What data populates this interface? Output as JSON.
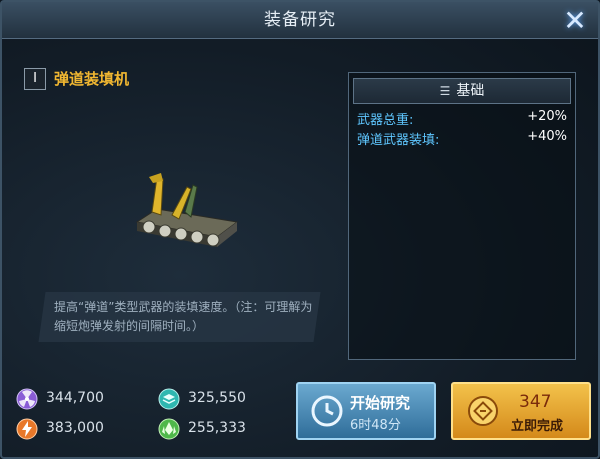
{
  "window": {
    "title": "装备研究",
    "close_icon": "close-icon"
  },
  "item": {
    "tier": "I",
    "name": "弹道装填机"
  },
  "description": "提高“弹道”类型武器的装填速度。（注：可理解为缩短炮弹发射的间隔时间。）",
  "stats": {
    "header": "基础",
    "rows": [
      {
        "label": "武器总重:",
        "value": "+20%"
      },
      {
        "label": "弹道武器装填:",
        "value": "+40%"
      }
    ]
  },
  "resources": [
    {
      "icon": "radiation-icon",
      "value": "344,700",
      "color": "#8a5cd6"
    },
    {
      "icon": "layers-icon",
      "value": "325,550",
      "color": "#2fb7b0"
    },
    {
      "icon": "energy-icon",
      "value": "383,000",
      "color": "#e8782a"
    },
    {
      "icon": "crystal-icon",
      "value": "255,333",
      "color": "#4fb84a"
    }
  ],
  "start_button": {
    "label": "开始研究",
    "time": "6时48分"
  },
  "finish_button": {
    "cost": "347",
    "label": "立即完成"
  }
}
